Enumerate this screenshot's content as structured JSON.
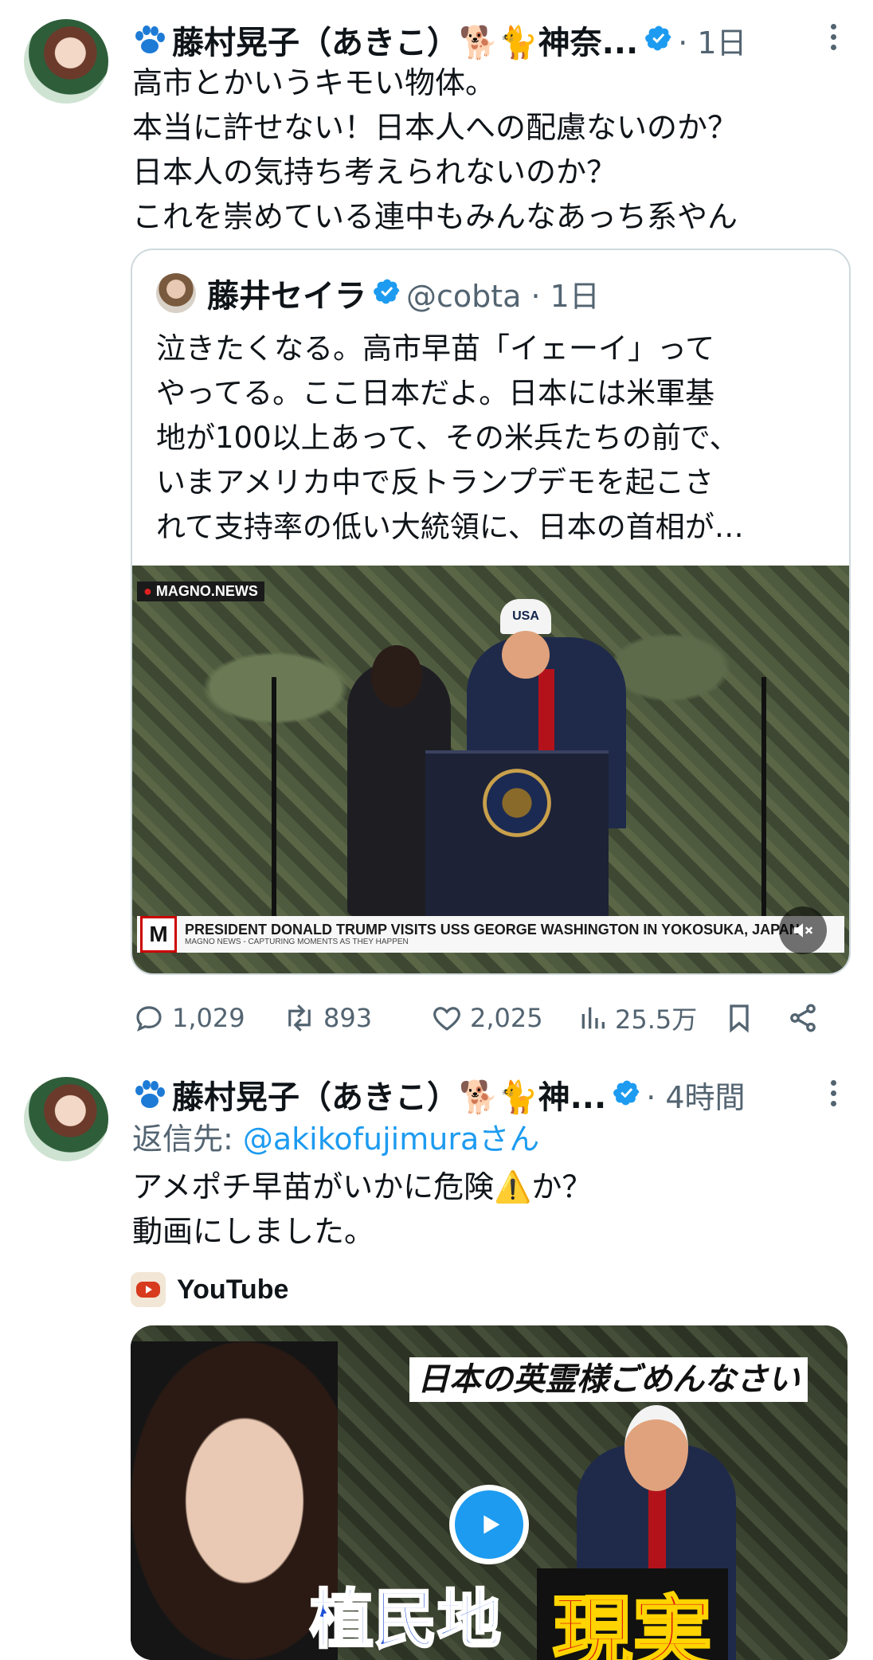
{
  "tweet1": {
    "name": "藤村晃子（あきこ）🐕🐈神奈...",
    "time": "· 1日",
    "text": "高市とかいうキモい物体。\n本当に許せない！日本人への配慮ないのか？\n日本人の気持ち考えられないのか？\nこれを崇めている連中もみんなあっち系やん",
    "quote": {
      "name": "藤井セイラ",
      "handle": "@cobta · 1日",
      "text": "泣きたくなる。高市早苗「イェーイ」って\nやってる。ここ日本だよ。日本には米軍基\n地が100以上あって、その米兵たちの前で、\nいまアメリカ中で反トランプデモを起こさ\nれて支持率の低い大統領に、日本の首相が…",
      "video": {
        "source_tag": "MAGNO.NEWS",
        "chyron": "PRESIDENT DONALD TRUMP VISITS USS GEORGE WASHINGTON IN YOKOSUKA, JAPAN",
        "chyron_sub": "MAGNO NEWS - CAPTURING MOMENTS AS THEY HAPPEN",
        "hat_text": "USA"
      }
    },
    "stats": {
      "replies": "1,029",
      "retweets": "893",
      "likes": "2,025",
      "views": "25.5万"
    }
  },
  "tweet2": {
    "name": "藤村晃子（あきこ）🐕🐈神...",
    "time": "· 4時間",
    "reply_prefix": "返信先: ",
    "reply_handle": "@akikofujimuraさん",
    "text": "アメポチ早苗がいかに危険⚠️か？\n動画にしました。",
    "card_source": "YouTube",
    "thumb": {
      "headline": "日本の英霊様ごめんなさい",
      "big_left": "植民地",
      "big_right": "現実"
    }
  },
  "colors": {
    "verified": "#1d9bf0",
    "link": "#1d9bf0",
    "muted": "#536471"
  },
  "icons": [
    "paw-icon",
    "verified-icon",
    "more-icon",
    "reply-icon",
    "retweet-icon",
    "like-icon",
    "views-icon",
    "bookmark-icon",
    "share-icon",
    "mute-icon",
    "play-icon",
    "youtube-icon"
  ]
}
